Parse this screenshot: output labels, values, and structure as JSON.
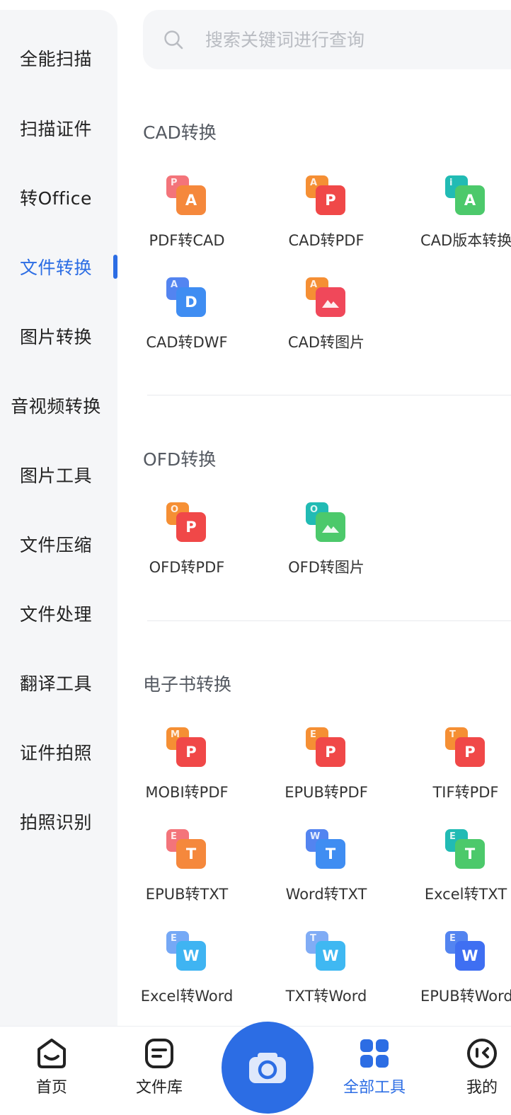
{
  "sidebar": {
    "items": [
      {
        "label": "全能扫描"
      },
      {
        "label": "扫描证件"
      },
      {
        "label": "转Office"
      },
      {
        "label": "文件转换",
        "active": true
      },
      {
        "label": "图片转换"
      },
      {
        "label": "音视频转换"
      },
      {
        "label": "图片工具"
      },
      {
        "label": "文件压缩"
      },
      {
        "label": "文件处理"
      },
      {
        "label": "翻译工具"
      },
      {
        "label": "证件拍照"
      },
      {
        "label": "拍照识别"
      }
    ]
  },
  "search": {
    "placeholder": "搜索关键词进行查询",
    "icon": "search-icon"
  },
  "sections": [
    {
      "title": "CAD转换",
      "tools": [
        {
          "label": "PDF转CAD",
          "back": "P",
          "front": "A",
          "back_color": "#f36d73",
          "front_color": "#f5883c"
        },
        {
          "label": "CAD转PDF",
          "back": "A",
          "front": "P",
          "back_color": "#f58a2a",
          "front_color": "#f04848"
        },
        {
          "label": "CAD版本转换",
          "back": "i",
          "front": "A",
          "back_color": "#16b8b0",
          "front_color": "#4cc96b"
        },
        {
          "label": "CAD转DWF",
          "back": "A",
          "front": "D",
          "back_color": "#4a7ef0",
          "front_color": "#3f8df2"
        },
        {
          "label": "CAD转图片",
          "back": "A",
          "front": "image",
          "back_color": "#f58a2a",
          "front_color": "#f0485a"
        }
      ]
    },
    {
      "title": "OFD转换",
      "tools": [
        {
          "label": "OFD转PDF",
          "back": "O",
          "front": "P",
          "back_color": "#f58a2a",
          "front_color": "#f04848"
        },
        {
          "label": "OFD转图片",
          "back": "O",
          "front": "image",
          "back_color": "#16b8b0",
          "front_color": "#4cc96b"
        }
      ]
    },
    {
      "title": "电子书转换",
      "tools": [
        {
          "label": "MOBI转PDF",
          "back": "M",
          "front": "P",
          "back_color": "#f58a2a",
          "front_color": "#f04848"
        },
        {
          "label": "EPUB转PDF",
          "back": "E",
          "front": "P",
          "back_color": "#f58a2a",
          "front_color": "#f04848"
        },
        {
          "label": "TIF转PDF",
          "back": "T",
          "front": "P",
          "back_color": "#f58a2a",
          "front_color": "#f04848"
        },
        {
          "label": "EPUB转TXT",
          "back": "E",
          "front": "T",
          "back_color": "#f36d73",
          "front_color": "#f5883c"
        },
        {
          "label": "Word转TXT",
          "back": "W",
          "front": "T",
          "back_color": "#4a7ef0",
          "front_color": "#3f8df2"
        },
        {
          "label": "Excel转TXT",
          "back": "E",
          "front": "T",
          "back_color": "#16b8b0",
          "front_color": "#4cc96b"
        },
        {
          "label": "Excel转Word",
          "back": "E",
          "front": "W",
          "back_color": "#6ea4f5",
          "front_color": "#3fb4f2"
        },
        {
          "label": "TXT转Word",
          "back": "T",
          "front": "W",
          "back_color": "#7aa8f5",
          "front_color": "#3fb8f2"
        },
        {
          "label": "EPUB转Word",
          "back": "E",
          "front": "W",
          "back_color": "#4a7ef0",
          "front_color": "#3f6ff2"
        }
      ]
    }
  ],
  "bottom_nav": {
    "items": [
      {
        "label": "首页",
        "icon": "home-icon"
      },
      {
        "label": "文件库",
        "icon": "file-library-icon"
      },
      {
        "label": "全部工具",
        "icon": "all-tools-icon",
        "active": true
      },
      {
        "label": "我的",
        "icon": "profile-icon"
      }
    ],
    "camera_icon": "camera-icon"
  },
  "colors": {
    "accent": "#2c6de4",
    "sidebar_bg": "#f5f6f8",
    "section_title": "#555a62"
  }
}
